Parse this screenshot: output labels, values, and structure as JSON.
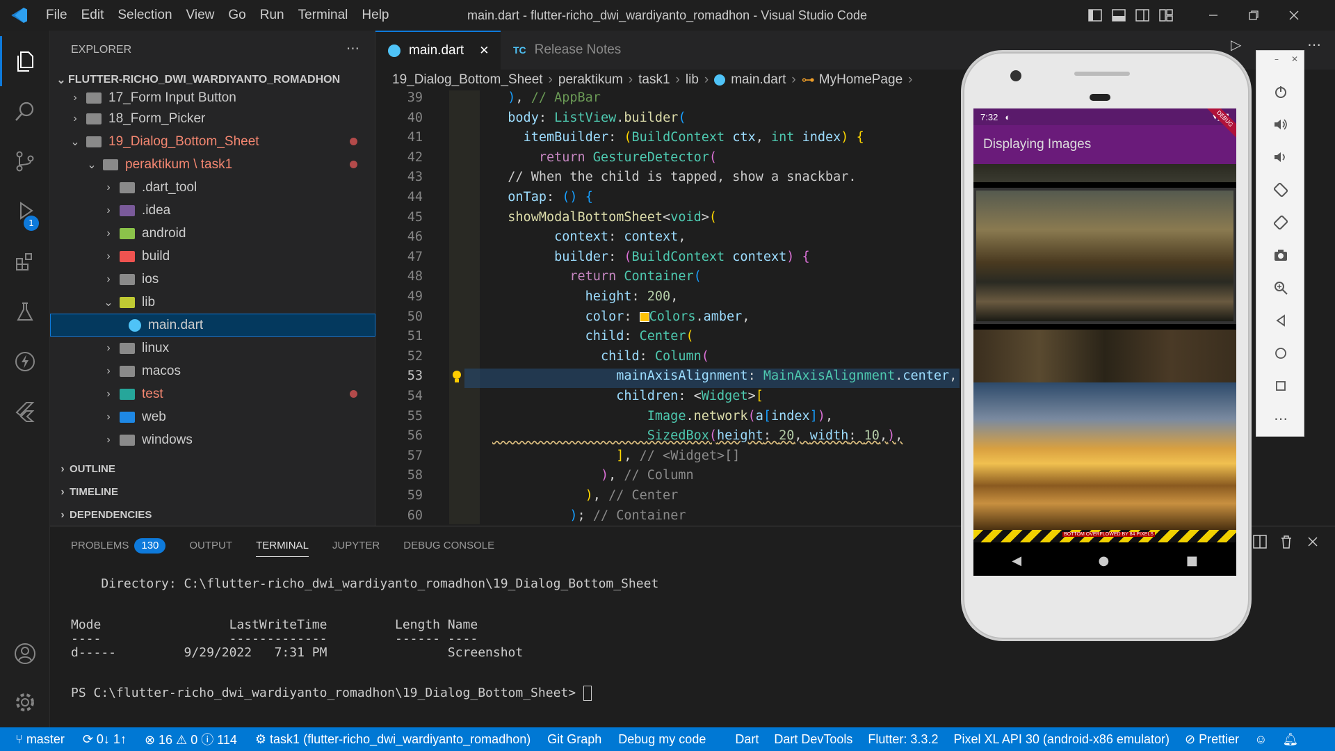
{
  "window": {
    "title": "main.dart - flutter-richo_dwi_wardiyanto_romadhon - Visual Studio Code"
  },
  "menu": [
    "File",
    "Edit",
    "Selection",
    "View",
    "Go",
    "Run",
    "Terminal",
    "Help"
  ],
  "explorer": {
    "header": "EXPLORER",
    "more": "···",
    "root": "FLUTTER-RICHO_DWI_WARDIYANTO_ROMADHON",
    "items": [
      {
        "label": "17_Form Input Button"
      },
      {
        "label": "18_Form_Picker"
      },
      {
        "label": "19_Dialog_Bottom_Sheet"
      },
      {
        "label": "peraktikum \\ task1"
      },
      {
        "label": ".dart_tool"
      },
      {
        "label": ".idea"
      },
      {
        "label": "android"
      },
      {
        "label": "build"
      },
      {
        "label": "ios"
      },
      {
        "label": "lib"
      },
      {
        "label": "main.dart"
      },
      {
        "label": "linux"
      },
      {
        "label": "macos"
      },
      {
        "label": "test"
      },
      {
        "label": "web"
      },
      {
        "label": "windows"
      }
    ],
    "sections": [
      "OUTLINE",
      "TIMELINE",
      "DEPENDENCIES"
    ]
  },
  "tabs": [
    {
      "label": "main.dart",
      "close": "✕"
    },
    {
      "label": "Release Notes",
      "prefix": "TC"
    }
  ],
  "breadcrumb": [
    "19_Dialog_Bottom_Sheet",
    "peraktikum",
    "task1",
    "lib",
    "main.dart",
    "MyHomePage"
  ],
  "code": {
    "line_numbers": [
      "39",
      "40",
      "41",
      "42",
      "43",
      "44",
      "45",
      "46",
      "47",
      "48",
      "49",
      "50",
      "51",
      "52",
      "53",
      "54",
      "55",
      "56",
      "57",
      "58",
      "59",
      "60"
    ],
    "current_line": "53"
  },
  "panel": {
    "tabs": [
      {
        "label": "PROBLEMS",
        "badge": "130"
      },
      {
        "label": "OUTPUT"
      },
      {
        "label": "TERMINAL"
      },
      {
        "label": "JUPYTER"
      },
      {
        "label": "DEBUG CONSOLE"
      }
    ],
    "terminal": {
      "directory": "    Directory: C:\\flutter-richo_dwi_wardiyanto_romadhon\\19_Dialog_Bottom_Sheet",
      "header": "Mode                 LastWriteTime         Length Name",
      "underline": "----                 -------------         ------ ----",
      "row": "d-----         9/29/2022   7:31 PM                Screenshot",
      "prompt": "PS C:\\flutter-richo_dwi_wardiyanto_romadhon\\19_Dialog_Bottom_Sheet> "
    }
  },
  "status": {
    "branch": "master",
    "sync": "0↓ 1↑",
    "problems": "⊗ 16 ⚠ 0 ⓘ 114",
    "task": "task1 (flutter-richo_dwi_wardiyanto_romadhon)",
    "git_graph": "Git Graph",
    "debug": "Debug my code",
    "lang": "Dart",
    "devtools": "Dart DevTools",
    "flutter": "Flutter: 3.3.2",
    "device": "Pixel XL API 30 (android-x86 emulator)",
    "prettier": "Prettier"
  },
  "emulator": {
    "time": "7:32",
    "app_title": "Displaying Images",
    "debug_banner": "DEBUG",
    "overflow_text": "BOTTOM OVERFLOWED BY 84 PIXELS",
    "toolbar_min": "–",
    "toolbar_close": "✕"
  },
  "colors": {
    "accent": "#0e7adb",
    "status": "#0078d4",
    "appbar": "#6a1b7a"
  }
}
